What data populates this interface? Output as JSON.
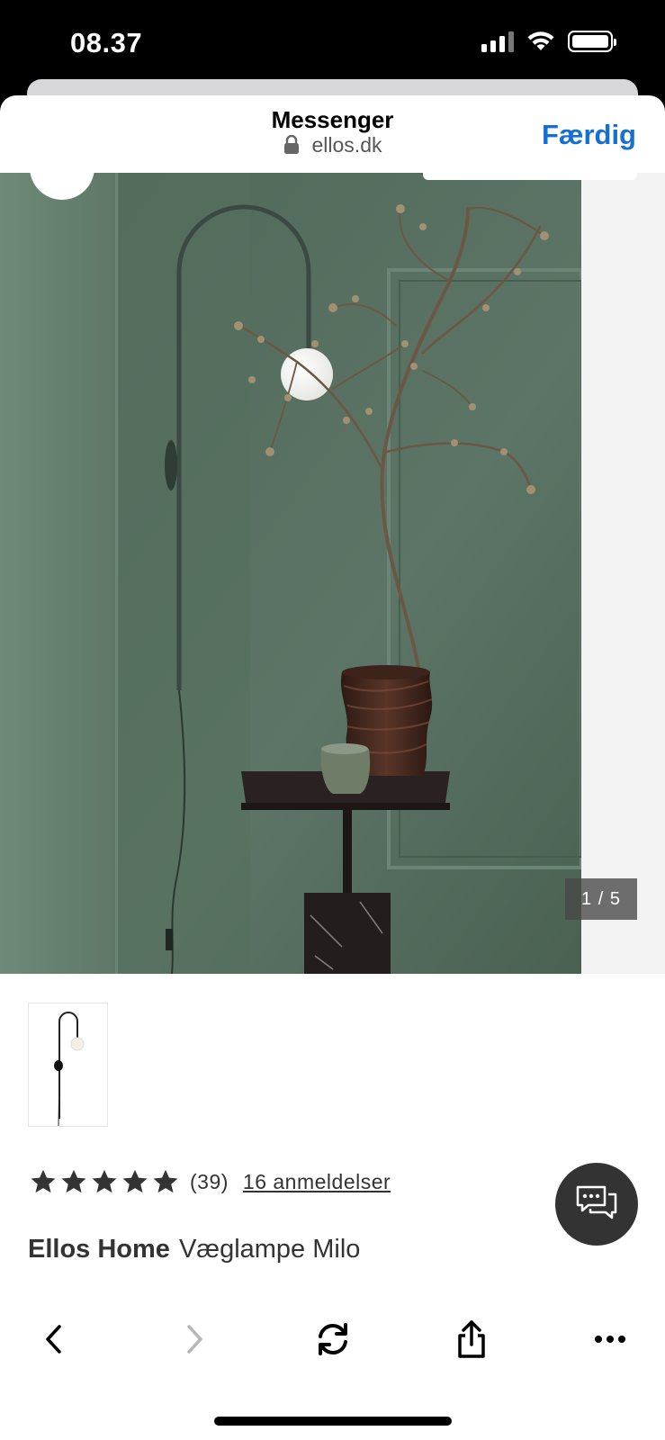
{
  "status_bar": {
    "time": "08.37"
  },
  "sheet": {
    "title": "Messenger",
    "url": "ellos.dk",
    "done_label": "Færdig"
  },
  "gallery": {
    "counter": "1 / 5"
  },
  "product": {
    "rating_stars": 5,
    "rating_count": "(39)",
    "reviews_link": "16 anmeldelser",
    "brand": "Ellos Home",
    "name": "Væglampe Milo"
  },
  "toolbar": {
    "icons": [
      "back-icon",
      "forward-icon",
      "reload-icon",
      "share-icon",
      "more-icon"
    ]
  },
  "colors": {
    "accent": "#1570d6",
    "wall_green": "#5e7767",
    "chat_button": "#333333"
  }
}
